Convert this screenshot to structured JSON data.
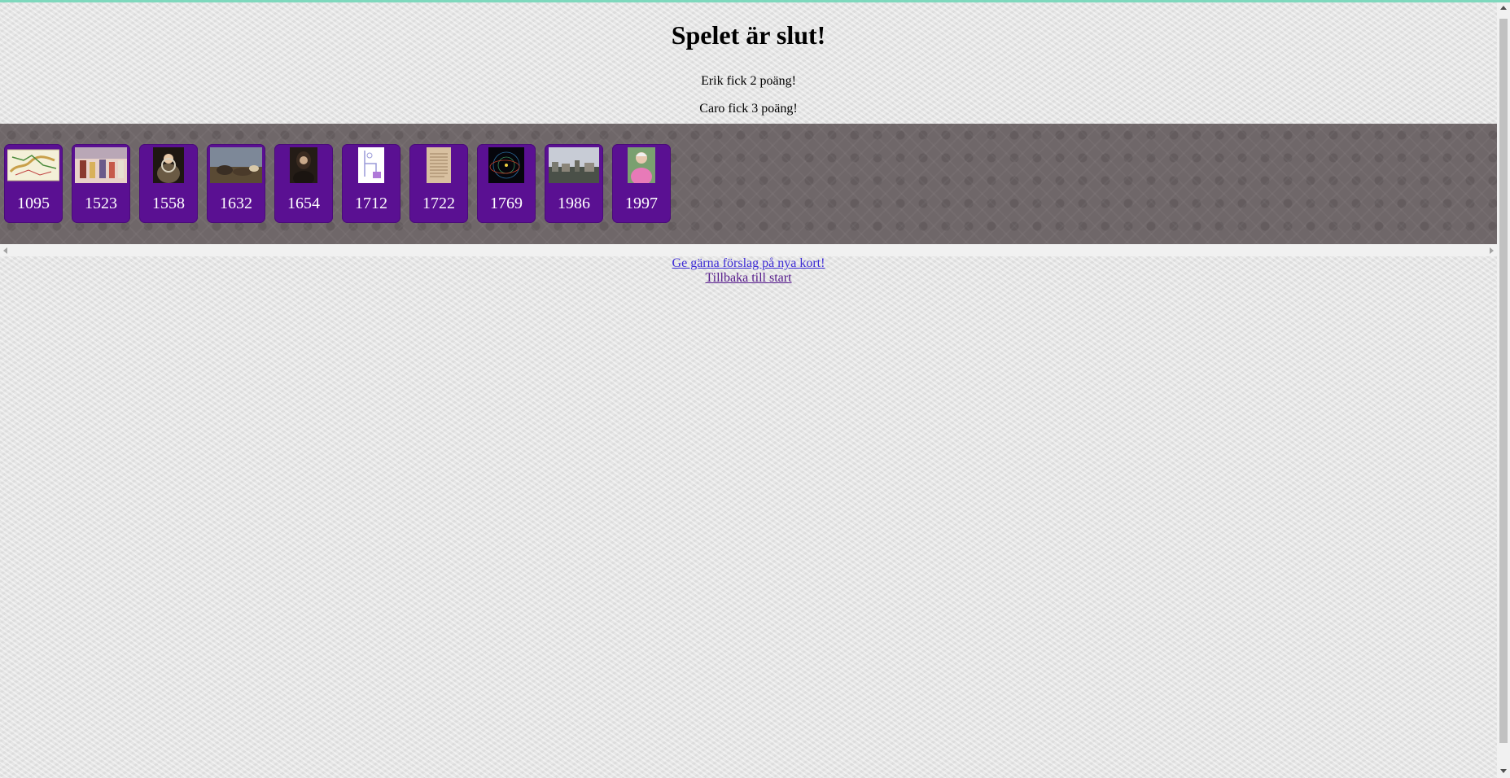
{
  "title": "Spelet är slut!",
  "scores": [
    "Erik fick 2 poäng!",
    "Caro fick 3 poäng!"
  ],
  "cards": [
    {
      "year": "1095",
      "image": "map-image"
    },
    {
      "year": "1523",
      "image": "painting-crowd-image"
    },
    {
      "year": "1558",
      "image": "portrait-queen-image"
    },
    {
      "year": "1632",
      "image": "battle-painting-image"
    },
    {
      "year": "1654",
      "image": "portrait-man-image"
    },
    {
      "year": "1712",
      "image": "diagram-image"
    },
    {
      "year": "1722",
      "image": "manuscript-image"
    },
    {
      "year": "1769",
      "image": "orbit-image"
    },
    {
      "year": "1986",
      "image": "cityscape-image"
    },
    {
      "year": "1997",
      "image": "photo-person-image"
    }
  ],
  "links": {
    "suggest": "Ge gärna förslag på nya kort!",
    "back": "Tillbaka till start"
  },
  "colors": {
    "card_bg": "#5a1092",
    "timeline_bg": "#6f6769",
    "link_visited": "#551a8b",
    "top_accent": "#7fd8bd"
  }
}
